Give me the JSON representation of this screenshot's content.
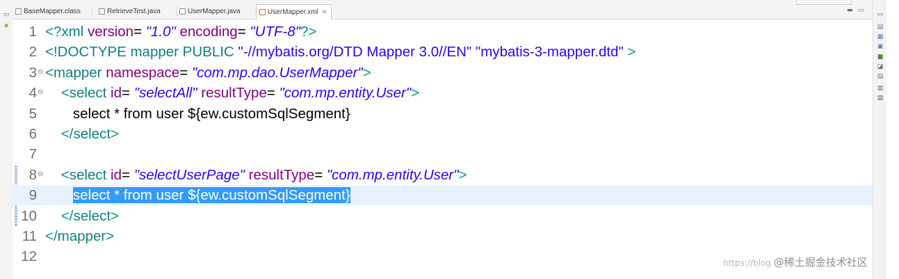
{
  "tabs": [
    {
      "label": "BaseMapper.class",
      "active": false,
      "icon": "class-file-icon"
    },
    {
      "label": "RetrieveTest.java",
      "active": false,
      "icon": "java-file-icon"
    },
    {
      "label": "UserMapper.java",
      "active": false,
      "icon": "java-file-icon"
    },
    {
      "label": "UserMapper.xml",
      "active": true,
      "icon": "xml-file-icon",
      "close": "✕"
    }
  ],
  "editor": {
    "lines": [
      {
        "num": "1",
        "fold": "",
        "tokens": [
          {
            "t": "<?",
            "c": "tk-bracket"
          },
          {
            "t": "xml",
            "c": "tk-tag"
          },
          {
            "t": " ",
            "c": "tk-text"
          },
          {
            "t": "version",
            "c": "tk-attr"
          },
          {
            "t": "= ",
            "c": "tk-eq"
          },
          {
            "t": "\"1.0\"",
            "c": "tk-str"
          },
          {
            "t": " ",
            "c": "tk-text"
          },
          {
            "t": "encoding",
            "c": "tk-attr"
          },
          {
            "t": "= ",
            "c": "tk-eq"
          },
          {
            "t": "\"UTF-8\"",
            "c": "tk-str"
          },
          {
            "t": "?>",
            "c": "tk-bracket"
          }
        ]
      },
      {
        "num": "2",
        "fold": "",
        "tokens": [
          {
            "t": "<!DOCTYPE ",
            "c": "tk-doctype"
          },
          {
            "t": "mapper",
            "c": "tk-tag"
          },
          {
            "t": " PUBLIC ",
            "c": "tk-doctype"
          },
          {
            "t": "\"-//mybatis.org/DTD Mapper 3.0//EN\"",
            "c": "tk-plain-str"
          },
          {
            "t": " ",
            "c": "tk-text"
          },
          {
            "t": "\"mybatis-3-mapper.dtd\"",
            "c": "tk-plain-str"
          },
          {
            "t": " >",
            "c": "tk-bracket"
          }
        ]
      },
      {
        "num": "3",
        "fold": "⊖",
        "tokens": [
          {
            "t": "<",
            "c": "tk-bracket"
          },
          {
            "t": "mapper",
            "c": "tk-tag"
          },
          {
            "t": " ",
            "c": "tk-text"
          },
          {
            "t": "namespace",
            "c": "tk-attr"
          },
          {
            "t": "= ",
            "c": "tk-eq"
          },
          {
            "t": "\"com.mp.dao.UserMapper\"",
            "c": "tk-str"
          },
          {
            "t": ">",
            "c": "tk-bracket"
          }
        ]
      },
      {
        "num": "4",
        "fold": "⊖",
        "tokens": [
          {
            "t": "    ",
            "c": "tk-text"
          },
          {
            "t": "<",
            "c": "tk-bracket"
          },
          {
            "t": "select",
            "c": "tk-tag"
          },
          {
            "t": " ",
            "c": "tk-text"
          },
          {
            "t": "id",
            "c": "tk-attr"
          },
          {
            "t": "= ",
            "c": "tk-eq"
          },
          {
            "t": "\"selectAll\"",
            "c": "tk-str"
          },
          {
            "t": " ",
            "c": "tk-text"
          },
          {
            "t": "resultType",
            "c": "tk-attr"
          },
          {
            "t": "= ",
            "c": "tk-eq"
          },
          {
            "t": "\"com.mp.entity.User\"",
            "c": "tk-str"
          },
          {
            "t": ">",
            "c": "tk-bracket"
          }
        ]
      },
      {
        "num": "5",
        "fold": "",
        "tokens": [
          {
            "t": "       select * from user ${ew.customSqlSegment}",
            "c": "tk-text"
          }
        ]
      },
      {
        "num": "6",
        "fold": "",
        "tokens": [
          {
            "t": "    ",
            "c": "tk-text"
          },
          {
            "t": "</",
            "c": "tk-bracket"
          },
          {
            "t": "select",
            "c": "tk-tag"
          },
          {
            "t": ">",
            "c": "tk-bracket"
          }
        ]
      },
      {
        "num": "7",
        "fold": "",
        "tokens": []
      },
      {
        "num": "8",
        "fold": "⊖",
        "tokens": [
          {
            "t": "    ",
            "c": "tk-text"
          },
          {
            "t": "<",
            "c": "tk-bracket"
          },
          {
            "t": "select",
            "c": "tk-tag"
          },
          {
            "t": " ",
            "c": "tk-text"
          },
          {
            "t": "id",
            "c": "tk-attr"
          },
          {
            "t": "= ",
            "c": "tk-eq"
          },
          {
            "t": "\"selectUserPage\"",
            "c": "tk-str"
          },
          {
            "t": " ",
            "c": "tk-text"
          },
          {
            "t": "resultType",
            "c": "tk-attr"
          },
          {
            "t": "= ",
            "c": "tk-eq"
          },
          {
            "t": "\"com.mp.entity.User\"",
            "c": "tk-str"
          },
          {
            "t": ">",
            "c": "tk-bracket"
          }
        ]
      },
      {
        "num": "9",
        "fold": "",
        "current": true,
        "tokens": [
          {
            "t": "       ",
            "c": "tk-text"
          },
          {
            "t": "select * from user ${ew.customSqlSegment}",
            "c": "tk-selected"
          }
        ]
      },
      {
        "num": "10",
        "fold": "",
        "tokens": [
          {
            "t": "    ",
            "c": "tk-text"
          },
          {
            "t": "</",
            "c": "tk-bracket"
          },
          {
            "t": "select",
            "c": "tk-tag"
          },
          {
            "t": ">",
            "c": "tk-bracket"
          }
        ]
      },
      {
        "num": "11",
        "fold": "",
        "tokens": [
          {
            "t": "</",
            "c": "tk-bracket"
          },
          {
            "t": "mapper",
            "c": "tk-tag"
          },
          {
            "t": ">",
            "c": "tk-bracket"
          }
        ]
      },
      {
        "num": "12",
        "fold": "",
        "tokens": []
      }
    ]
  },
  "watermark": {
    "url": "https://blog",
    "site": "@稀土掘金技术社区"
  },
  "colors": {
    "selection": "#3399ff",
    "current_line": "#e8f2fe",
    "tag": "#0f7f7f",
    "attribute": "#7f007f",
    "string": "#2a00ff"
  }
}
